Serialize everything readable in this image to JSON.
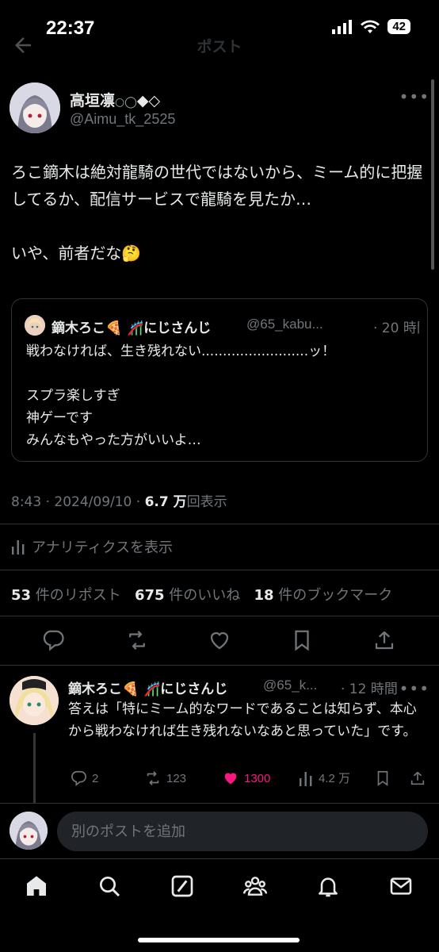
{
  "status_bar": {
    "time": "22:37",
    "battery": "42"
  },
  "header": {
    "title": "ポスト"
  },
  "post": {
    "author_name": "高垣凛",
    "author_name_suffix": "◆◇",
    "author_handle": "@Aimu_tk_2525",
    "text": "ろこ鏑木は絶対龍騎の世代ではないから、ミーム的に把握してるか、配信サービスで龍騎を見たか…\n\nいや、前者だな🤔",
    "quote": {
      "name": "鏑木ろこ🍕 🎢にじさんじ",
      "handle": "@65_kabu...",
      "time": "· 20 時間",
      "text": "戦わなければ、生き残れない.........................ッ！\n\nスプラ楽しすぎ\n神ゲーです\nみんなもやった方がいいよ…"
    },
    "timestamp": "8:43 · 2024/09/10 · ",
    "views_value": "6.7 万",
    "views_label": "回表示",
    "analytics_label": "アナリティクスを表示",
    "reposts_count": "53",
    "reposts_label": "件のリポスト",
    "likes_count": "675",
    "likes_label": "件のいいね",
    "bookmarks_count": "18",
    "bookmarks_label": "件のブックマーク"
  },
  "reply": {
    "name": "鏑木ろこ🍕 🎢にじさんじ",
    "handle": "@65_k...",
    "time": "· 12 時間",
    "text": "答えは「特にミーム的なワードであることは知らず、本心から戦わなければ生き残れないなあと思っていた」です。",
    "replies": "2",
    "reposts": "123",
    "likes": "1300",
    "views": "4.2 万",
    "like_color": "#f91880"
  },
  "compose": {
    "placeholder": "別のポストを追加"
  },
  "tabbar": {
    "items": [
      "home-icon",
      "search-icon",
      "grok-icon",
      "communities-icon",
      "notifications-icon",
      "messages-icon"
    ]
  }
}
